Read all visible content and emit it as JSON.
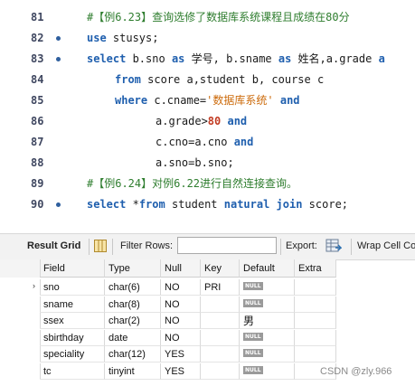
{
  "editor": {
    "lines": [
      {
        "no": "81",
        "marker": false,
        "indent": 0,
        "segments": [
          {
            "t": "cmt",
            "v": "#【例6.23】查询选修了数据库系统课程且成绩在80分"
          }
        ]
      },
      {
        "no": "82",
        "marker": true,
        "indent": 0,
        "segments": [
          {
            "t": "kw",
            "v": "use"
          },
          {
            "t": "id",
            "v": " stusys;"
          }
        ]
      },
      {
        "no": "83",
        "marker": true,
        "indent": 0,
        "segments": [
          {
            "t": "kw",
            "v": "select"
          },
          {
            "t": "id",
            "v": " b.sno "
          },
          {
            "t": "kw",
            "v": "as"
          },
          {
            "t": "id",
            "v": " 学号, b.sname "
          },
          {
            "t": "kw",
            "v": "as"
          },
          {
            "t": "id",
            "v": " 姓名,a.grade "
          },
          {
            "t": "kw",
            "v": "a"
          }
        ]
      },
      {
        "no": "84",
        "marker": false,
        "indent": 1,
        "segments": [
          {
            "t": "kw",
            "v": "from"
          },
          {
            "t": "id",
            "v": " score a,student b, course c"
          }
        ]
      },
      {
        "no": "85",
        "marker": false,
        "indent": 1,
        "segments": [
          {
            "t": "kw",
            "v": "where"
          },
          {
            "t": "id",
            "v": " c.cname="
          },
          {
            "t": "str",
            "v": "'数据库系统'"
          },
          {
            "t": "id",
            "v": " "
          },
          {
            "t": "kw",
            "v": "and"
          }
        ]
      },
      {
        "no": "86",
        "marker": false,
        "indent": 2,
        "segments": [
          {
            "t": "id",
            "v": "a.grade>"
          },
          {
            "t": "num",
            "v": "80"
          },
          {
            "t": "id",
            "v": " "
          },
          {
            "t": "kw",
            "v": "and"
          }
        ]
      },
      {
        "no": "87",
        "marker": false,
        "indent": 2,
        "segments": [
          {
            "t": "id",
            "v": "c.cno=a.cno "
          },
          {
            "t": "kw",
            "v": "and"
          }
        ]
      },
      {
        "no": "88",
        "marker": false,
        "indent": 2,
        "segments": [
          {
            "t": "id",
            "v": "a.sno=b.sno;"
          }
        ]
      },
      {
        "no": "89",
        "marker": false,
        "indent": 0,
        "segments": [
          {
            "t": "cmt",
            "v": "#【例6.24】对例6.22进行自然连接查询。"
          }
        ]
      },
      {
        "no": "90",
        "marker": true,
        "indent": 0,
        "segments": [
          {
            "t": "kw",
            "v": "select"
          },
          {
            "t": "id",
            "v": " *"
          },
          {
            "t": "kw",
            "v": "from"
          },
          {
            "t": "id",
            "v": " student "
          },
          {
            "t": "kw",
            "v": "natural join"
          },
          {
            "t": "id",
            "v": " score;"
          }
        ]
      }
    ]
  },
  "toolbar": {
    "result_grid_label": "Result Grid",
    "filter_rows_label": "Filter Rows:",
    "filter_rows_value": "",
    "export_label": "Export:",
    "wrap_label": "Wrap Cell Co"
  },
  "table": {
    "columns": [
      "Field",
      "Type",
      "Null",
      "Key",
      "Default",
      "Extra"
    ],
    "rows": [
      {
        "field": "sno",
        "type": "char(6)",
        "null": "NO",
        "key": "PRI",
        "default": "NULL",
        "default_is_null": true,
        "extra": "",
        "current": true
      },
      {
        "field": "sname",
        "type": "char(8)",
        "null": "NO",
        "key": "",
        "default": "NULL",
        "default_is_null": true,
        "extra": "",
        "current": false
      },
      {
        "field": "ssex",
        "type": "char(2)",
        "null": "NO",
        "key": "",
        "default": "男",
        "default_is_null": false,
        "extra": "",
        "current": false
      },
      {
        "field": "sbirthday",
        "type": "date",
        "null": "NO",
        "key": "",
        "default": "NULL",
        "default_is_null": true,
        "extra": "",
        "current": false
      },
      {
        "field": "speciality",
        "type": "char(12)",
        "null": "YES",
        "key": "",
        "default": "NULL",
        "default_is_null": true,
        "extra": "",
        "current": false
      },
      {
        "field": "tc",
        "type": "tinyint",
        "null": "YES",
        "key": "",
        "default": "NULL",
        "default_is_null": true,
        "extra": "",
        "current": false
      }
    ]
  },
  "watermark": "CSDN @zly.966",
  "colors": {
    "keyword": "#1f5fae",
    "comment": "#2e7d2e",
    "string": "#cc6a0a",
    "number": "#c23b22"
  },
  "icons": {
    "result_grid": "grid-icon",
    "export": "export-icon",
    "line_marker": "statement-dot-icon"
  }
}
